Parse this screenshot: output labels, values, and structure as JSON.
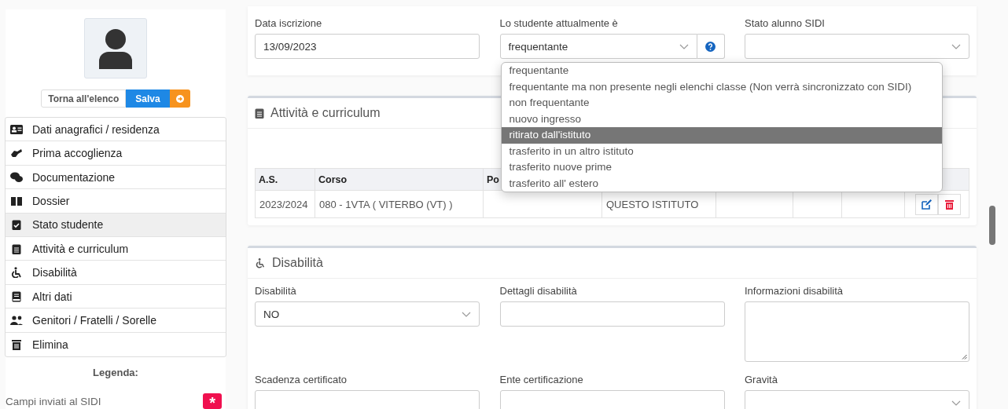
{
  "sidebar": {
    "back_button": "Torna all'elenco",
    "save_button": "Salva",
    "items": [
      {
        "label": "Dati anagrafici / residenza",
        "selected": false
      },
      {
        "label": "Prima accoglienza",
        "selected": false
      },
      {
        "label": "Documentazione",
        "selected": false
      },
      {
        "label": "Dossier",
        "selected": false
      },
      {
        "label": "Stato studente",
        "selected": true
      },
      {
        "label": "Attività e curriculum",
        "selected": false
      },
      {
        "label": "Disabilità",
        "selected": false
      },
      {
        "label": "Altri dati",
        "selected": false
      },
      {
        "label": "Genitori / Fratelli / Sorelle",
        "selected": false
      },
      {
        "label": "Elimina",
        "selected": false
      }
    ],
    "legend": {
      "title": "Legenda:",
      "items": [
        {
          "label": "Campi inviati al SIDI",
          "badge": "*"
        }
      ]
    }
  },
  "status_card": {
    "fields": [
      {
        "label": "Data iscrizione",
        "kind": "input",
        "value": "13/09/2023"
      },
      {
        "label": "Lo studente attualmente è",
        "kind": "select_help",
        "value": "frequentante"
      },
      {
        "label": "Stato alunno SIDI",
        "kind": "select"
      }
    ]
  },
  "status_dropdown": {
    "options": [
      {
        "label": "frequentante",
        "selected": false
      },
      {
        "label": "frequentante ma non presente negli elenchi classe (Non verrà sincronizzato con SIDI)",
        "selected": false
      },
      {
        "label": "non frequentante",
        "selected": false
      },
      {
        "label": "nuovo ingresso",
        "selected": false
      },
      {
        "label": "ritirato dall'istituto",
        "selected": true
      },
      {
        "label": "trasferito in un altro istituto",
        "selected": false
      },
      {
        "label": "trasferito nuove prime",
        "selected": false
      },
      {
        "label": "trasferito all' estero",
        "selected": false
      }
    ]
  },
  "activities": {
    "title": "Attività e curriculum",
    "columns": [
      "A.S.",
      "Corso",
      "Po"
    ],
    "rows": [
      [
        "2023/2024",
        "080 - 1VTA ( VITERBO (VT) )",
        "",
        "QUESTO ISTITUTO",
        "",
        "",
        ""
      ]
    ]
  },
  "disability": {
    "title": "Disabilità",
    "fields": [
      {
        "label": "Disabilità",
        "kind": "select",
        "value": "NO"
      },
      {
        "label": "Dettagli disabilità",
        "kind": "input"
      },
      {
        "label": "Informazioni disabilità",
        "kind": "textarea"
      },
      {
        "label": "Scadenza certificato",
        "kind": "input"
      },
      {
        "label": "Ente certificazione",
        "kind": "input"
      },
      {
        "label": "Gravità",
        "kind": "select"
      }
    ]
  }
}
